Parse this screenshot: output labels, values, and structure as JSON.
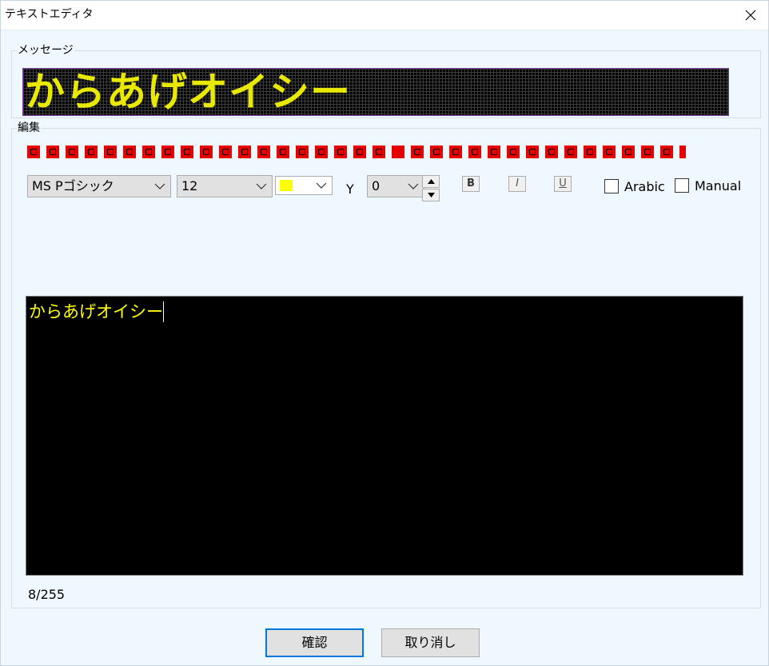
{
  "window": {
    "title": "テキストエディタ"
  },
  "message_group": {
    "label": "メッセージ",
    "led_preview_text": "からあげオイシー"
  },
  "edit_group": {
    "label": "編集",
    "symbol_icons": [
      "symbol-1-icon",
      "symbol-2-icon",
      "symbol-3-icon",
      "symbol-4-icon",
      "symbol-5-icon",
      "symbol-6-icon",
      "symbol-7-icon",
      "symbol-8-icon",
      "symbol-9-icon",
      "symbol-10-icon",
      "symbol-11-icon",
      "symbol-12-icon",
      "symbol-13-icon",
      "symbol-14-icon",
      "symbol-15-icon",
      "symbol-16-icon",
      "symbol-17-icon",
      "symbol-18-icon",
      "symbol-19-icon",
      "symbol-20-icon",
      "symbol-21-icon",
      "symbol-22-icon",
      "symbol-23-icon",
      "symbol-24-icon",
      "symbol-25-icon",
      "symbol-26-icon",
      "symbol-27-icon",
      "symbol-28-icon",
      "symbol-29-icon",
      "symbol-30-icon",
      "symbol-31-icon",
      "symbol-32-icon",
      "symbol-33-icon",
      "symbol-34-icon",
      "symbol-35-icon"
    ],
    "font_name": "MS Pゴシック",
    "font_size": "12",
    "text_color": "#ffff00",
    "y_label": "Y",
    "y_value": "0",
    "bold_label": "B",
    "italic_label": "I",
    "underline_label": "U",
    "arabic_label": "Arabic",
    "arabic_checked": false,
    "manual_label": "Manual",
    "manual_checked": false,
    "editor_text": "からあげオイシー",
    "char_count": "8/255"
  },
  "buttons": {
    "ok": "確認",
    "cancel": "取り消し"
  },
  "colors": {
    "accent": "#0078d7",
    "led_text": "#e8e800",
    "symbol": "#e60000",
    "background": "#f0f8ff"
  }
}
